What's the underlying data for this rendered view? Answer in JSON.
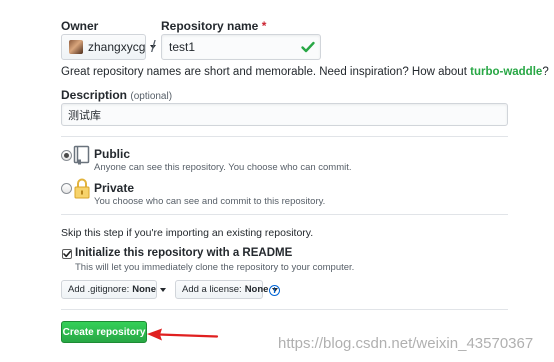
{
  "owner": {
    "label": "Owner",
    "selected": "zhangxycg"
  },
  "repository": {
    "label": "Repository name",
    "required_mark": "*",
    "separator": "/",
    "value": "test1"
  },
  "hint": {
    "prefix": "Great repository names are short and memorable. Need inspiration? How about ",
    "suggestion": "turbo-waddle",
    "suffix": "?"
  },
  "description": {
    "label": "Description",
    "optional": "(optional)",
    "value": "测试库"
  },
  "visibility": {
    "selected": "public",
    "public": {
      "title": "Public",
      "note": "Anyone can see this repository. You choose who can commit."
    },
    "private": {
      "title": "Private",
      "note": "You choose who can see and commit to this repository."
    }
  },
  "import_note": "Skip this step if you're importing an existing repository.",
  "readme": {
    "checked": true,
    "label": "Initialize this repository with a README",
    "note": "This will let you immediately clone the repository to your computer."
  },
  "gitignore": {
    "prefix": "Add .gitignore:",
    "value": "None"
  },
  "license": {
    "prefix": "Add a license:",
    "value": "None"
  },
  "info_icon": "i",
  "submit": {
    "label": "Create repository"
  },
  "annotation": {
    "color": "#e02020",
    "icon": "red-arrow-icon"
  },
  "watermark": "https://blog.csdn.net/weixin_43570367",
  "colors": {
    "accent_green": "#28a745",
    "link_blue": "#0366d6",
    "required_red": "#cb2431"
  }
}
